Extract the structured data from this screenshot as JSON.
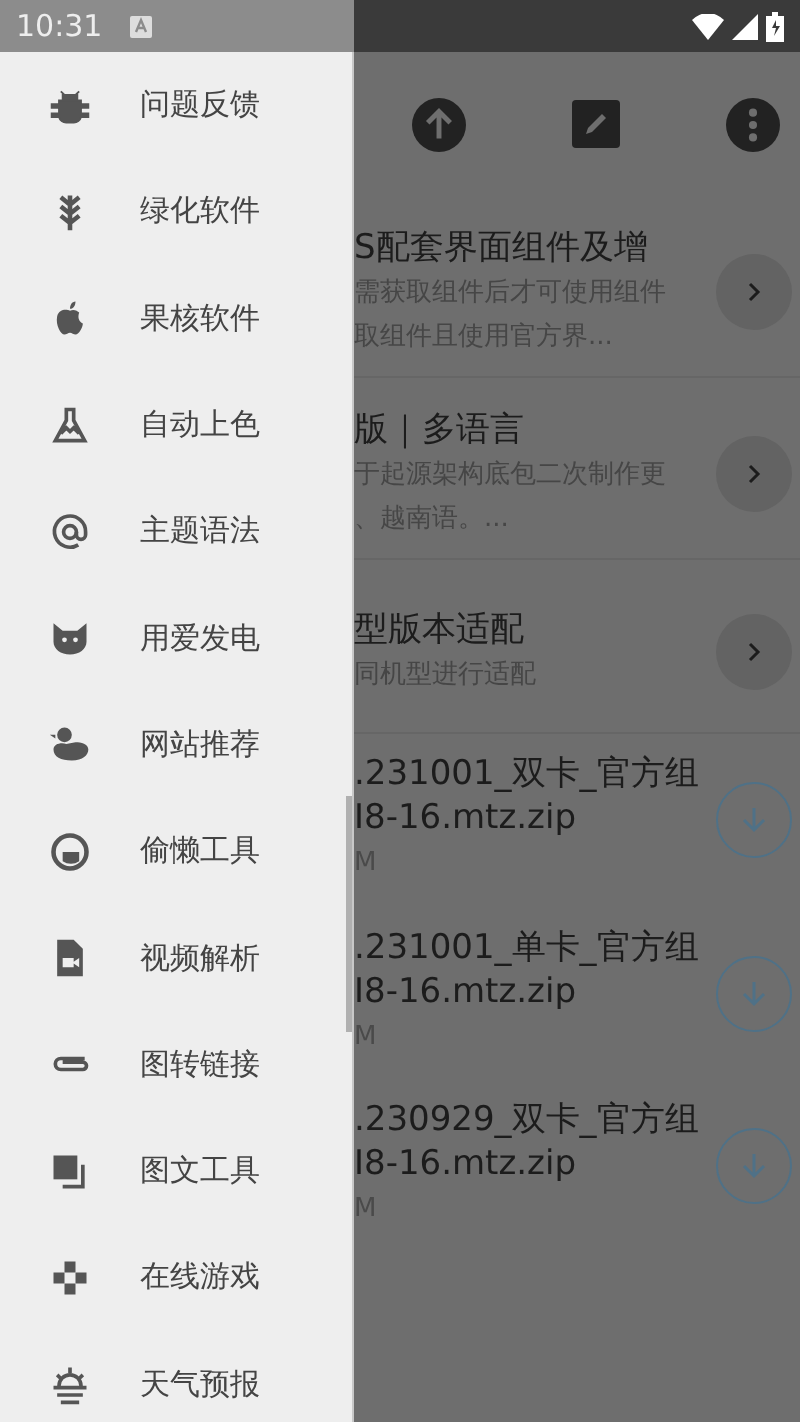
{
  "status_bar": {
    "time": "10:31"
  },
  "drawer": {
    "items": [
      {
        "label": "问题反馈"
      },
      {
        "label": "绿化软件"
      },
      {
        "label": "果核软件"
      },
      {
        "label": "自动上色"
      },
      {
        "label": "主题语法"
      },
      {
        "label": "用爱发电"
      },
      {
        "label": "网站推荐"
      },
      {
        "label": "偷懒工具"
      },
      {
        "label": "视频解析"
      },
      {
        "label": "图转链接"
      },
      {
        "label": "图文工具"
      },
      {
        "label": "在线游戏"
      },
      {
        "label": "天气预报"
      }
    ]
  },
  "list": [
    {
      "kind": "link",
      "title": "S配套界面组件及增",
      "lines": [
        "需获取组件后才可使用组件",
        "取组件且使用官方界..."
      ]
    },
    {
      "kind": "link",
      "title": "版｜多语言",
      "lines": [
        "于起源架构底包二次制作更",
        "、越南语。..."
      ]
    },
    {
      "kind": "link",
      "title": "型版本适配",
      "lines": [
        "同机型进行适配"
      ]
    },
    {
      "kind": "file",
      "title": ".231001_双卡_官方组",
      "lines": [
        "I8-16.mtz.zip"
      ],
      "size": "M"
    },
    {
      "kind": "file",
      "title": ".231001_单卡_官方组",
      "lines": [
        "I8-16.mtz.zip"
      ],
      "size": "M"
    },
    {
      "kind": "file",
      "title": ".230929_双卡_官方组",
      "lines": [
        "I8-16.mtz.zip"
      ],
      "size": "M"
    }
  ]
}
